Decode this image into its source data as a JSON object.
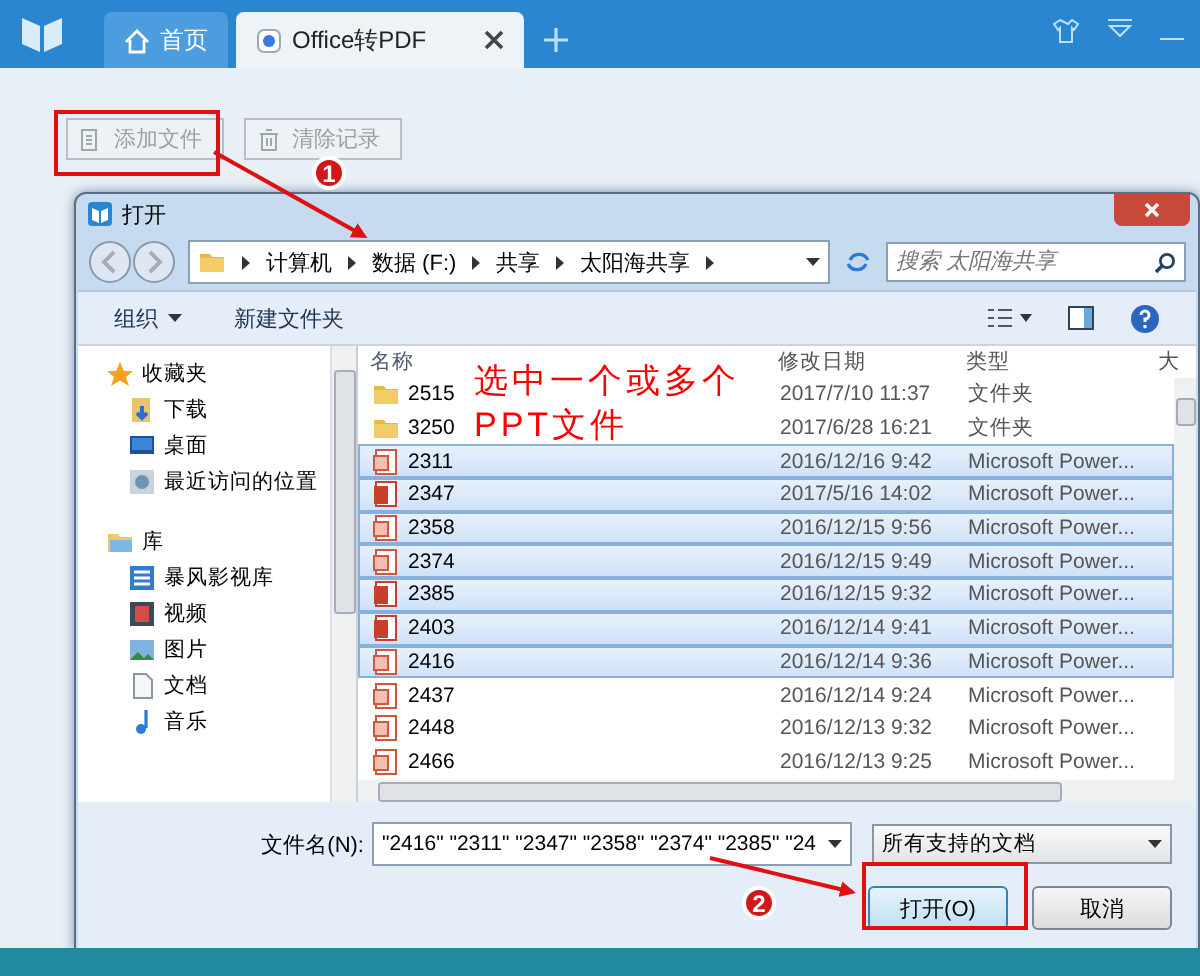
{
  "app": {
    "tabs": [
      {
        "label": "首页",
        "kind": "home",
        "selected": false
      },
      {
        "label": "Office转PDF",
        "kind": "doc",
        "selected": true
      }
    ],
    "buttons": [
      {
        "label": "添加文件",
        "kind": "add"
      },
      {
        "label": "清除记录",
        "kind": "clear"
      }
    ]
  },
  "dialog": {
    "title": "打开",
    "breadcrumb": [
      "计算机",
      "数据 (F:)",
      "共享",
      "太阳海共享"
    ],
    "search": {
      "placeholder": "搜索 太阳海共享"
    },
    "commands": [
      {
        "label": "组织",
        "dropdown": true
      },
      {
        "label": "新建文件夹",
        "dropdown": false
      }
    ],
    "nav": [
      {
        "label": "收藏夹",
        "children": [
          {
            "label": "下载"
          },
          {
            "label": "桌面"
          },
          {
            "label": "最近访问的位置"
          }
        ]
      },
      {
        "label": "库",
        "children": [
          {
            "label": "暴风影视库"
          },
          {
            "label": "视频"
          },
          {
            "label": "图片"
          },
          {
            "label": "文档"
          },
          {
            "label": "音乐"
          }
        ]
      }
    ],
    "columns": [
      "名称",
      "修改日期",
      "类型",
      "大"
    ],
    "files": [
      {
        "name": "2515",
        "modified": "2017/7/10 11:37",
        "type": "文件夹",
        "kind": "folder",
        "selected": false
      },
      {
        "name": "3250",
        "modified": "2017/6/28 16:21",
        "type": "文件夹",
        "kind": "folder",
        "selected": false
      },
      {
        "name": "2311",
        "modified": "2016/12/16 9:42",
        "type": "Microsoft Power...",
        "kind": "ppt",
        "selected": true
      },
      {
        "name": "2347",
        "modified": "2017/5/16 14:02",
        "type": "Microsoft Power...",
        "kind": "pptx",
        "selected": true
      },
      {
        "name": "2358",
        "modified": "2016/12/15 9:56",
        "type": "Microsoft Power...",
        "kind": "ppt",
        "selected": true
      },
      {
        "name": "2374",
        "modified": "2016/12/15 9:49",
        "type": "Microsoft Power...",
        "kind": "ppt",
        "selected": true
      },
      {
        "name": "2385",
        "modified": "2016/12/15 9:32",
        "type": "Microsoft Power...",
        "kind": "pptx",
        "selected": true
      },
      {
        "name": "2403",
        "modified": "2016/12/14 9:41",
        "type": "Microsoft Power...",
        "kind": "pptx",
        "selected": true
      },
      {
        "name": "2416",
        "modified": "2016/12/14 9:36",
        "type": "Microsoft Power...",
        "kind": "ppt",
        "selected": true
      },
      {
        "name": "2437",
        "modified": "2016/12/14 9:24",
        "type": "Microsoft Power...",
        "kind": "ppt",
        "selected": false
      },
      {
        "name": "2448",
        "modified": "2016/12/13 9:32",
        "type": "Microsoft Power...",
        "kind": "ppt",
        "selected": false
      },
      {
        "name": "2466",
        "modified": "2016/12/13 9:25",
        "type": "Microsoft Power...",
        "kind": "ppt",
        "selected": false
      }
    ],
    "filename": {
      "label": "文件名(N):",
      "value": "\"2416\" \"2311\" \"2347\" \"2358\" \"2374\" \"2385\" \"24"
    },
    "filter": "所有支持的文档",
    "buttons": [
      {
        "label": "打开(O)",
        "kind": "primary"
      },
      {
        "label": "取消",
        "kind": "normal"
      }
    ]
  },
  "annotations": {
    "note_lines": [
      "选中一个或多个",
      "PPT文件"
    ],
    "markers": [
      "1",
      "2"
    ]
  }
}
